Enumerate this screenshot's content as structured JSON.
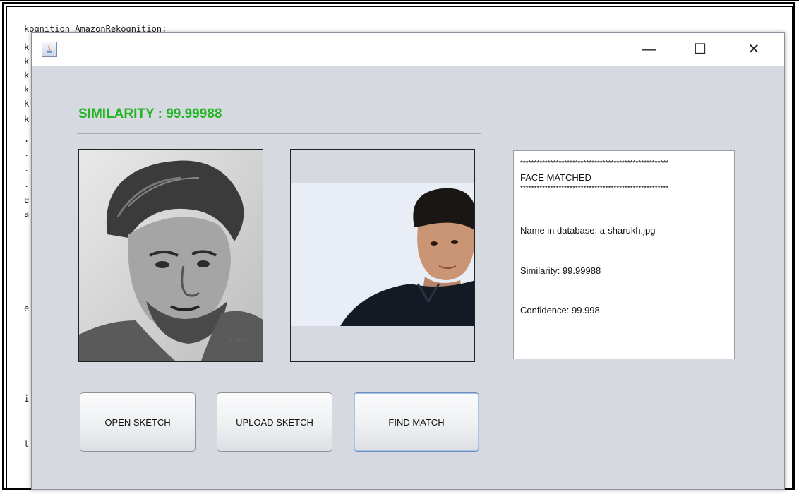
{
  "background_code": {
    "top_line": "kognition AmazonRekognition;",
    "gutter": [
      "k",
      "k",
      "k",
      "k",
      "k",
      "k",
      ".",
      ".",
      ".",
      ".",
      "e",
      "a",
      "e",
      "i",
      "t"
    ]
  },
  "window": {
    "controls": {
      "minimize": "—",
      "maximize": "☐",
      "close": "✕"
    }
  },
  "main": {
    "similarity_heading": "SIMILARITY : 99.99988",
    "similarity_color": "#22b522"
  },
  "images": {
    "sketch_icon": "pencil-sketch-portrait",
    "photo_icon": "matched-photo-portrait"
  },
  "result": {
    "stars_top": "******************************************************",
    "status": "FACE MATCHED",
    "stars_bottom": "******************************************************",
    "name_line": "Name in database: a-sharukh.jpg",
    "similarity_line": "Similarity: 99.99988",
    "confidence_line": "Confidence: 99.998"
  },
  "buttons": {
    "open_sketch": "OPEN SKETCH",
    "upload_sketch": "UPLOAD SKETCH",
    "find_match": "FIND MATCH"
  }
}
